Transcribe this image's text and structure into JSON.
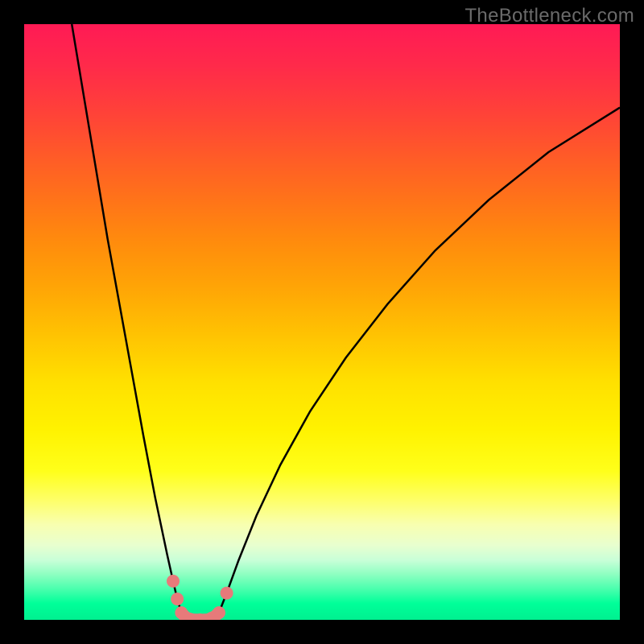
{
  "watermark": "TheBottleneck.com",
  "colors": {
    "curve": "#000000",
    "marker": "#e77a7a",
    "gradient_top": "#ff1a55",
    "gradient_bottom": "#00f090"
  },
  "chart_data": {
    "type": "line",
    "title": "",
    "xlabel": "",
    "ylabel": "",
    "xlim": [
      0,
      100
    ],
    "ylim": [
      0,
      100
    ],
    "series": [
      {
        "name": "left-curve",
        "x": [
          8,
          10,
          12,
          14,
          16,
          18,
          20,
          22,
          24,
          25,
          25.7,
          26.4
        ],
        "y": [
          100,
          88,
          76,
          64,
          53,
          42,
          31,
          20.5,
          11,
          6.5,
          3.5,
          1.2
        ]
      },
      {
        "name": "right-curve",
        "x": [
          32.7,
          34,
          36,
          39,
          43,
          48,
          54,
          61,
          69,
          78,
          88,
          100
        ],
        "y": [
          1.2,
          4.5,
          10,
          17.5,
          26,
          35,
          44,
          53,
          62,
          70.5,
          78.5,
          86
        ]
      },
      {
        "name": "bottom-arc",
        "x": [
          26.4,
          27.2,
          28.3,
          29.5,
          30.8,
          31.8,
          32.7
        ],
        "y": [
          1.2,
          0.35,
          0.05,
          0,
          0.05,
          0.4,
          1.2
        ]
      }
    ],
    "markers": [
      {
        "x": 25.0,
        "y": 6.5
      },
      {
        "x": 25.7,
        "y": 3.5
      },
      {
        "x": 26.4,
        "y": 1.2
      },
      {
        "x": 27.5,
        "y": 0.2
      },
      {
        "x": 29.5,
        "y": 0.0
      },
      {
        "x": 31.5,
        "y": 0.3
      },
      {
        "x": 32.7,
        "y": 1.2
      },
      {
        "x": 34.0,
        "y": 4.5
      }
    ]
  }
}
